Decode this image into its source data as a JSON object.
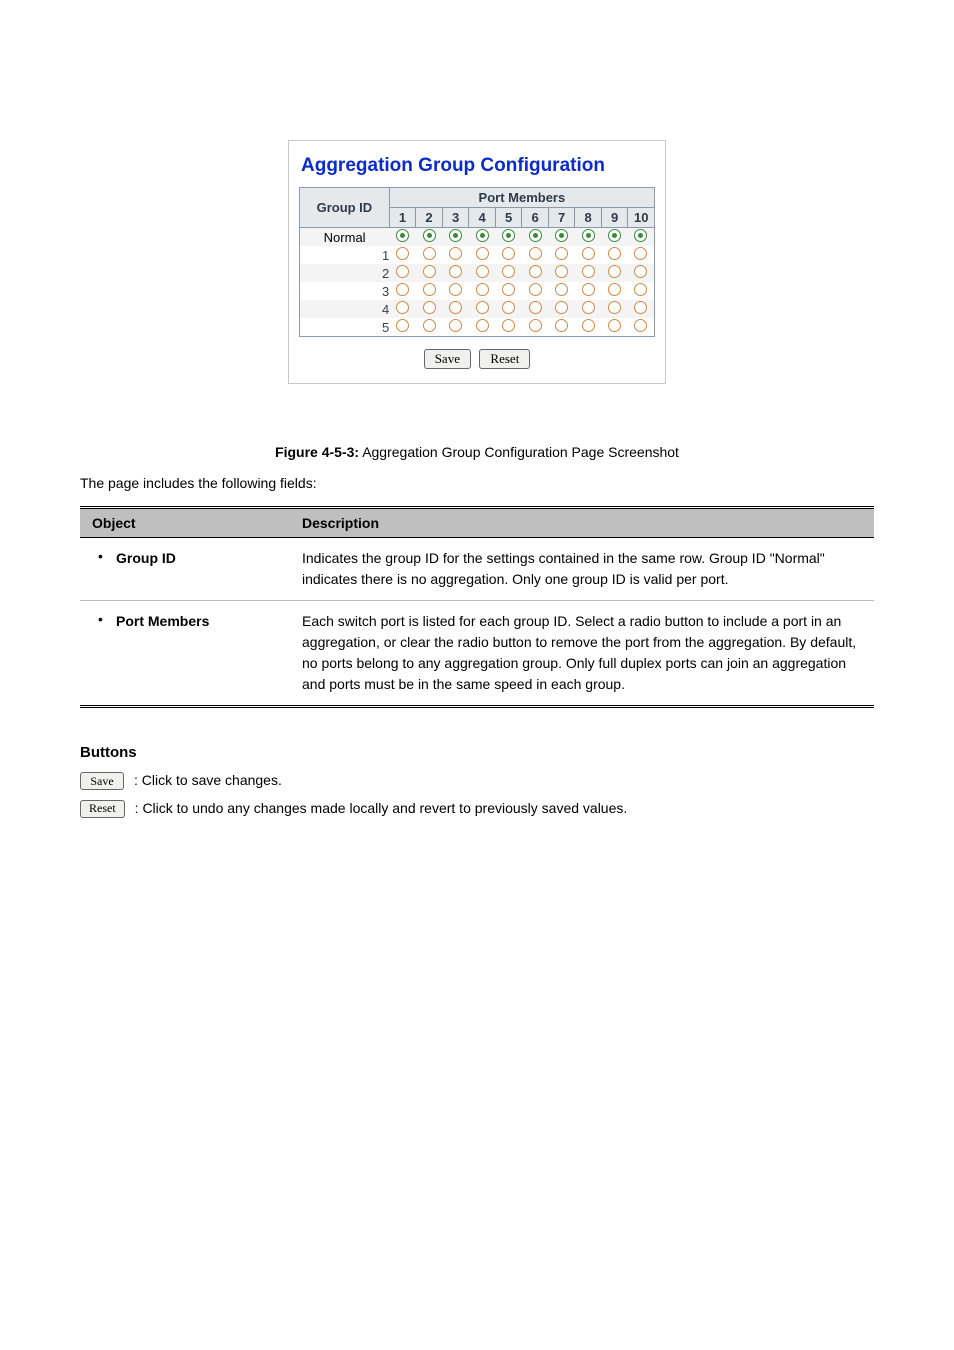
{
  "config_panel": {
    "title": "Aggregation Group Configuration",
    "headers": {
      "group_id": "Group ID",
      "port_members": "Port Members"
    },
    "ports": [
      "1",
      "2",
      "3",
      "4",
      "5",
      "6",
      "7",
      "8",
      "9",
      "10"
    ],
    "rows": [
      {
        "label": "Normal",
        "selected": [
          true,
          true,
          true,
          true,
          true,
          true,
          true,
          true,
          true,
          true
        ]
      },
      {
        "label": "1",
        "selected": [
          false,
          false,
          false,
          false,
          false,
          false,
          false,
          false,
          false,
          false
        ]
      },
      {
        "label": "2",
        "selected": [
          false,
          false,
          false,
          false,
          false,
          false,
          false,
          false,
          false,
          false
        ]
      },
      {
        "label": "3",
        "selected": [
          false,
          false,
          false,
          false,
          false,
          false,
          false,
          false,
          false,
          false
        ]
      },
      {
        "label": "4",
        "selected": [
          false,
          false,
          false,
          false,
          false,
          false,
          false,
          false,
          false,
          false
        ]
      },
      {
        "label": "5",
        "selected": [
          false,
          false,
          false,
          false,
          false,
          false,
          false,
          false,
          false,
          false
        ]
      }
    ],
    "buttons": {
      "save": "Save",
      "reset": "Reset"
    }
  },
  "figure_caption": {
    "prefix": "Figure 4-5-3:",
    "text": "Aggregation Group Configuration Page Screenshot"
  },
  "page_text": "The page includes the following fields:",
  "desc_table": {
    "th_object": "Object",
    "th_description": "Description",
    "rows": [
      {
        "object": "Group ID",
        "desc": "Indicates the group ID for the settings contained in the same row. Group ID \"Normal\" indicates there is no aggregation. Only one group ID is valid per port."
      },
      {
        "object": "Port Members",
        "desc": "Each switch port is listed for each group ID. Select a radio button to include a port in an aggregation, or clear the radio button to remove the port from the aggregation. By default, no ports belong to any aggregation group. Only full duplex ports can join an aggregation and ports must be in the same speed in each group."
      }
    ]
  },
  "buttons_section": {
    "title": "Buttons",
    "save": {
      "label": "Save",
      "text": ": Click to save changes."
    },
    "reset": {
      "label": "Reset",
      "text": ": Click to undo any changes made locally and revert to previously saved values."
    }
  }
}
